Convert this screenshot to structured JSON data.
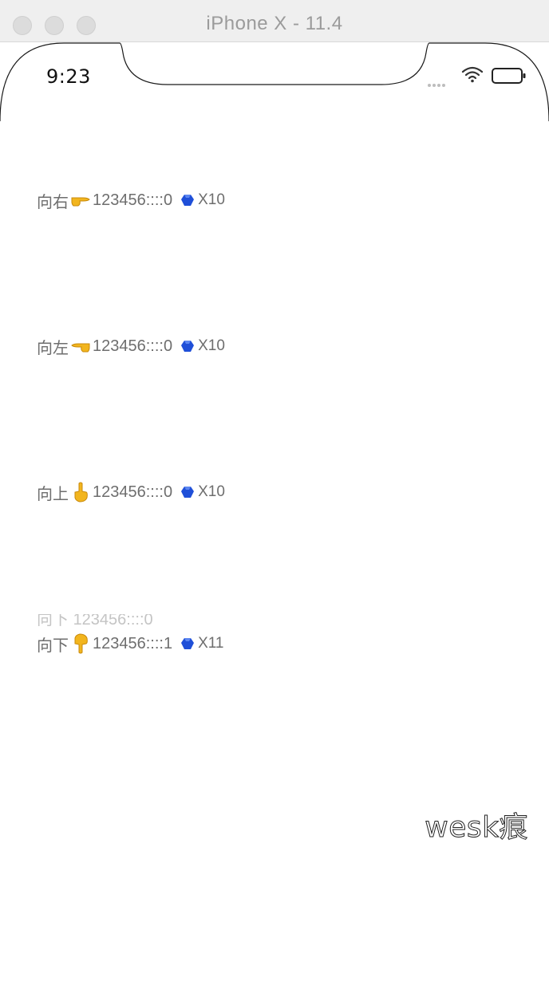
{
  "window": {
    "title": "iPhone X - 11.4"
  },
  "status_bar": {
    "time": "9:23",
    "icons": [
      "signal-dots-icon",
      "wifi-icon",
      "battery-icon"
    ]
  },
  "rows": [
    {
      "command": "向右",
      "hand": "pointing-right-icon",
      "value": "123456::::0",
      "gem": "blue-gem-icon",
      "count": "X10"
    },
    {
      "command": "向左",
      "hand": "pointing-left-icon",
      "value": "123456::::0",
      "gem": "blue-gem-icon",
      "count": "X10"
    },
    {
      "command": "向上",
      "hand": "pointing-up-icon",
      "value": "123456::::0",
      "gem": "blue-gem-icon",
      "count": "X10"
    },
    {
      "command": "向下",
      "hand": "pointing-down-icon",
      "value": "123456::::1",
      "gem": "blue-gem-icon",
      "count": "X11"
    }
  ],
  "watermark": "wesk痕",
  "colors": {
    "text": "#6e6e6e",
    "gem": "#1f4fd8",
    "hand": "#f2b51e"
  }
}
